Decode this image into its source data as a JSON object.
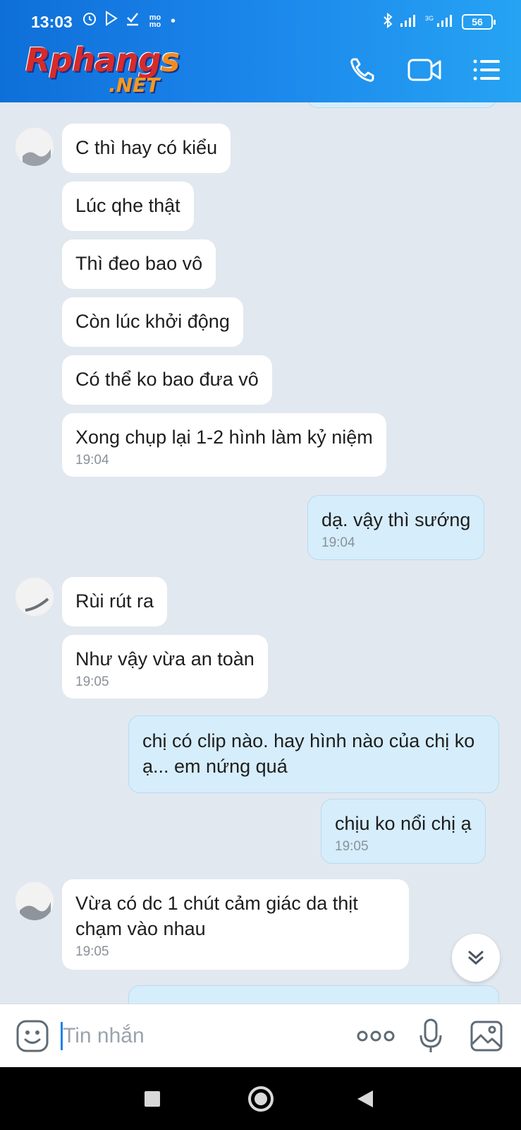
{
  "status_bar": {
    "time": "13:03",
    "network_label": "3G",
    "battery": "56"
  },
  "header": {
    "logo_main": "Rphang",
    "logo_main_end": "s",
    "logo_sub": ".NET",
    "colors": {
      "header_start": "#0e6fd8",
      "header_end": "#26a3f3"
    }
  },
  "messages": [
    {
      "side": "in",
      "text": "C thì hay có kiểu",
      "time": ""
    },
    {
      "side": "in",
      "text": "Lúc qhe thật",
      "time": ""
    },
    {
      "side": "in",
      "text": "Thì đeo bao vô",
      "time": ""
    },
    {
      "side": "in",
      "text": "Còn lúc khởi động",
      "time": ""
    },
    {
      "side": "in",
      "text": "Có thể ko bao đưa vô",
      "time": ""
    },
    {
      "side": "in",
      "text": "Xong chụp lại 1-2 hình làm kỷ niệm",
      "time": "19:04"
    },
    {
      "side": "out",
      "text": "dạ. vậy thì sướng",
      "time": "19:04"
    },
    {
      "side": "in",
      "text": "Rùi rút ra",
      "time": ""
    },
    {
      "side": "in",
      "text": "Như vậy vừa an toàn",
      "time": "19:05"
    },
    {
      "side": "out",
      "text": "chị có clip nào. hay hình nào của chị ko ạ... em nứng quá",
      "time": ""
    },
    {
      "side": "out",
      "text": "chịu ko nổi chị ạ",
      "time": "19:05"
    },
    {
      "side": "in",
      "text": "Vừa có dc 1 chút cảm giác da thịt chạm vào nhau",
      "time": "19:05"
    }
  ],
  "composer": {
    "placeholder": "Tin nhắn"
  },
  "icons": {
    "call": "phone-icon",
    "video": "video-camera-icon",
    "menu": "list-menu-icon",
    "emoji": "emoji-icon",
    "more": "more-dots-icon",
    "mic": "microphone-icon",
    "image": "image-icon",
    "scroll": "chevron-double-down-icon"
  }
}
